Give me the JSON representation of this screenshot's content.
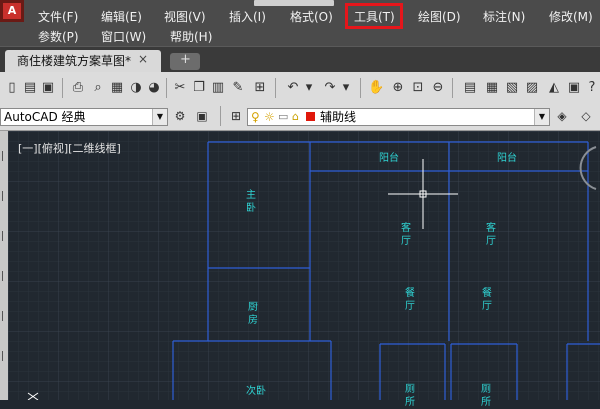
{
  "menubar": {
    "row1": [
      "文件(F)",
      "编辑(E)",
      "视图(V)",
      "插入(I)",
      "格式(O)",
      "工具(T)",
      "绘图(D)",
      "标注(N)",
      "修改(M)"
    ],
    "row2": [
      "参数(P)",
      "窗口(W)",
      "帮助(H)"
    ],
    "highlighted": "工具(T)"
  },
  "tabs": {
    "document": "商住楼建筑方案草图*",
    "close_glyph": "×",
    "new_tab_glyph": "+"
  },
  "toolbar2": {
    "workspace": "AutoCAD 经典",
    "layer": "辅助线"
  },
  "canvas": {
    "viewport_label": "[一][俯视][二维线框]",
    "rooms": {
      "balcony_1": "阳台",
      "balcony_2": "阳台",
      "master_bedroom": "主卧",
      "living_1": "客厅",
      "living_2": "客厅",
      "kitchen": "厨房",
      "dining_1": "餐厅",
      "dining_2": "餐厅",
      "second_bedroom": "次卧",
      "bath_1": "厕所",
      "bath_2": "厕所"
    }
  },
  "colors": {
    "highlight": "#e5161b",
    "wall_lines": "#2f5fd8",
    "room_text": "#2fd3d3",
    "canvas_bg": "#212830"
  }
}
